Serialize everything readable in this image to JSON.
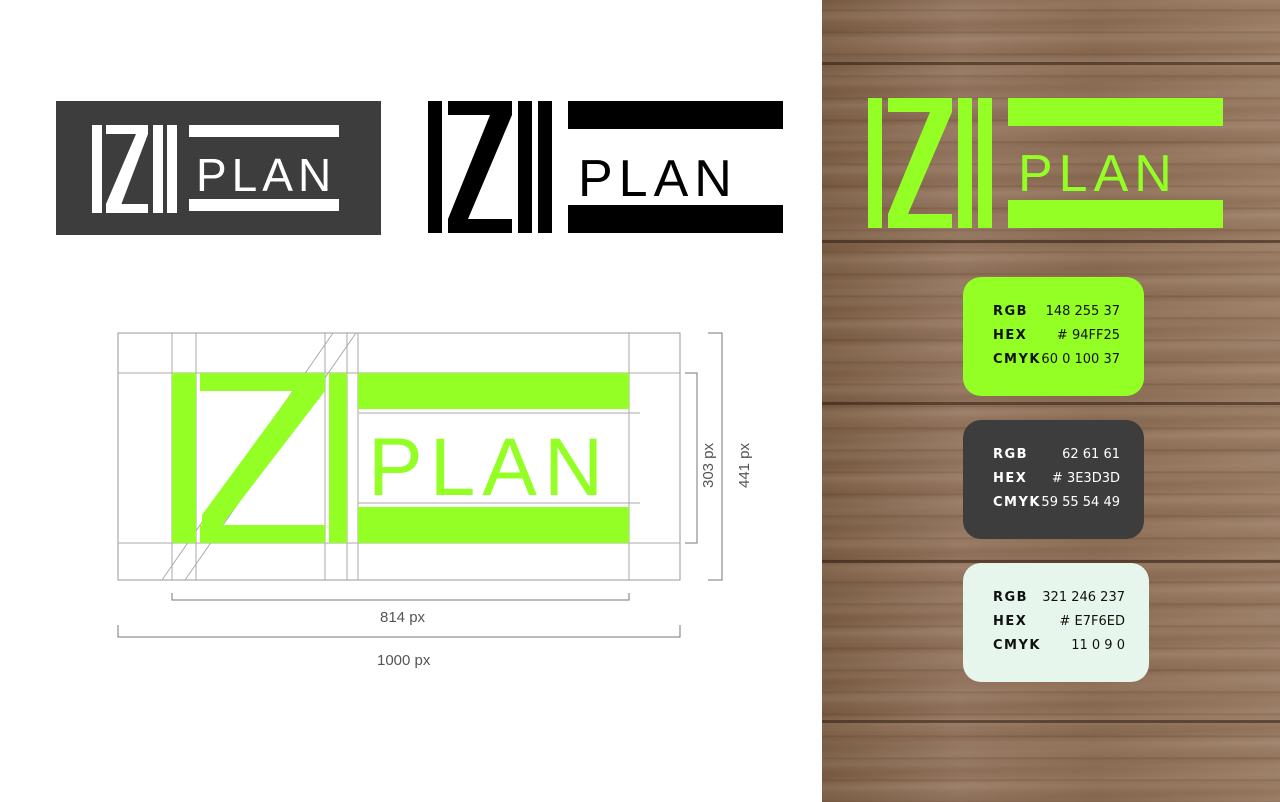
{
  "brand": {
    "logo_text_left": "IZI",
    "logo_text_right": "PLAN"
  },
  "colors": {
    "brand_green": "#94FF25",
    "dark_gray": "#3E3D3D",
    "light_mint": "#E7F6ED",
    "black": "#000000",
    "white": "#FFFFFF",
    "guide_gray": "#999999"
  },
  "dimensions": {
    "inner_width_label": "814 px",
    "outer_width_label": "1000 px",
    "inner_height_label": "303 px",
    "outer_height_label": "441 px"
  },
  "swatches": [
    {
      "rgb_label": "RGB",
      "rgb": "148 255 37",
      "hex_label": "HEX",
      "hex": "# 94FF25",
      "cmyk_label": "CMYK",
      "cmyk": "60 0 100 37"
    },
    {
      "rgb_label": "RGB",
      "rgb": "62 61 61",
      "hex_label": "HEX",
      "hex": "# 3E3D3D",
      "cmyk_label": "CMYK",
      "cmyk": "59 55 54 49"
    },
    {
      "rgb_label": "RGB",
      "rgb": "321 246 237",
      "hex_label": "HEX",
      "hex": "# E7F6ED",
      "cmyk_label": "CMYK",
      "cmyk": "11 0 9 0"
    }
  ]
}
